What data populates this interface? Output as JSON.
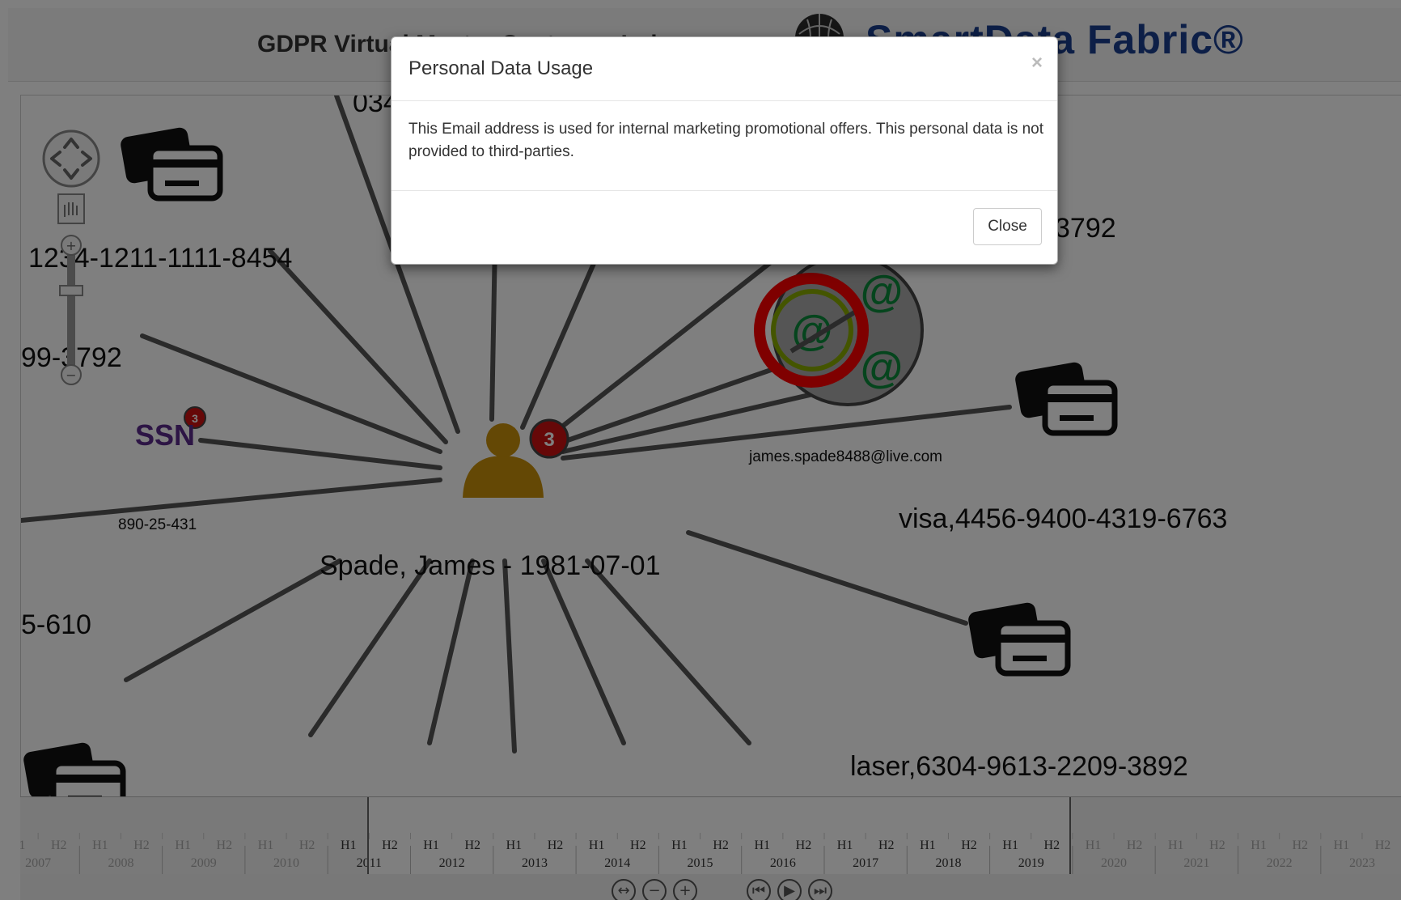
{
  "header": {
    "title": "GDPR Virtual Master Customer Index",
    "brand": "SmartData Fabric®"
  },
  "graph": {
    "person": {
      "label": "Spade, James - 1981-07-01",
      "badge_count": "3"
    },
    "ssn": {
      "icon_text": "SSN",
      "badge_count": "3",
      "value": "890-25-431"
    },
    "labels": {
      "card_top_left": "1234-1211-1111-8454",
      "phone_left": "99-3792",
      "partial_bottom_left": "5-610",
      "partial_top": "034",
      "phone_top_right": "3792",
      "email_address": "james.spade8488@live.com",
      "visa_card": "visa,4456-9400-4319-6763",
      "laser_card": "laser,6304-9613-2209-3892"
    },
    "email_glyph": "@"
  },
  "timeline": {
    "years": [
      "2007",
      "2008",
      "2009",
      "2010",
      "2011",
      "2012",
      "2013",
      "2014",
      "2015",
      "2016",
      "2017",
      "2018",
      "2019",
      "2020",
      "2021",
      "2022",
      "2023"
    ],
    "halves": [
      "H1",
      "H2"
    ]
  },
  "modal": {
    "title": "Personal Data Usage",
    "close_x": "×",
    "body": "This Email address is used for internal marketing promotional offers. This personal data is not provided to third-parties.",
    "close_label": "Close"
  },
  "colors": {
    "person": "#c8900a",
    "email_green": "#0a8a3a",
    "ssn_purple": "#5a2a8a",
    "highlight_red": "#ff0000",
    "badge_red": "#cc1111"
  }
}
